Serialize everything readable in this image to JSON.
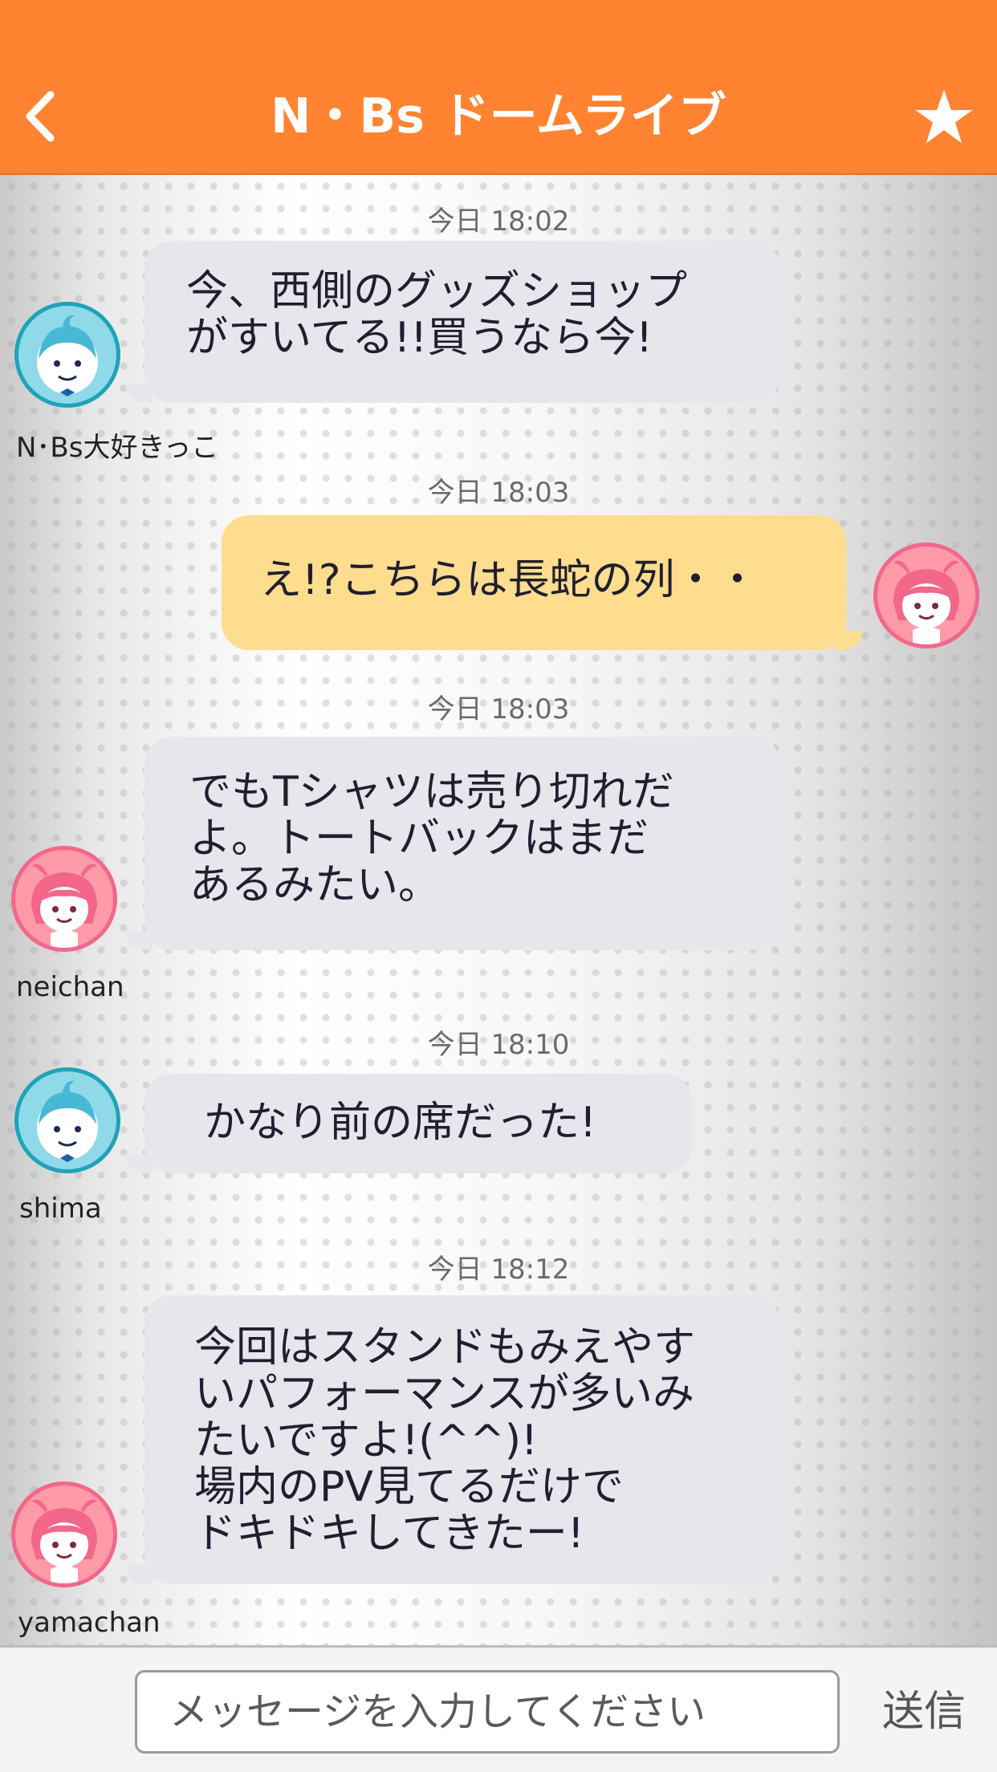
{
  "header": {
    "title": "N・Bs ドームライブ",
    "back_icon": "chevron-left-icon",
    "star_icon": "star-icon",
    "background": "#ff8331"
  },
  "messages": [
    {
      "time": "今日 18:02",
      "text": "今、西側のグッズショップ\nがすいてる!!買うなら今!",
      "user": "N･Bs大好きっこ",
      "avatar": "boy-avatar",
      "self": false
    },
    {
      "time": "今日 18:03",
      "text": "え!?こちらは長蛇の列・・",
      "user": "",
      "avatar": "girl-avatar",
      "self": true
    },
    {
      "time": "今日 18:03",
      "text": "でもTシャツは売り切れだ\nよ。トートバックはまだ\nあるみたい。",
      "user": "neichan",
      "avatar": "girl-avatar",
      "self": false
    },
    {
      "time": "今日 18:10",
      "text": "かなり前の席だった!",
      "user": "shima",
      "avatar": "boy-avatar",
      "self": false
    },
    {
      "time": "今日 18:12",
      "text": "今回はスタンドもみえやす\nいパフォーマンスが多いみ\nたいですよ!(^^)!\n場内のPV見てるだけで\nドキドキしてきたー!",
      "user": "yamachan",
      "avatar": "girl-avatar",
      "self": false
    }
  ],
  "composer": {
    "placeholder": "メッセージを入力してください",
    "send_label": "送信"
  }
}
